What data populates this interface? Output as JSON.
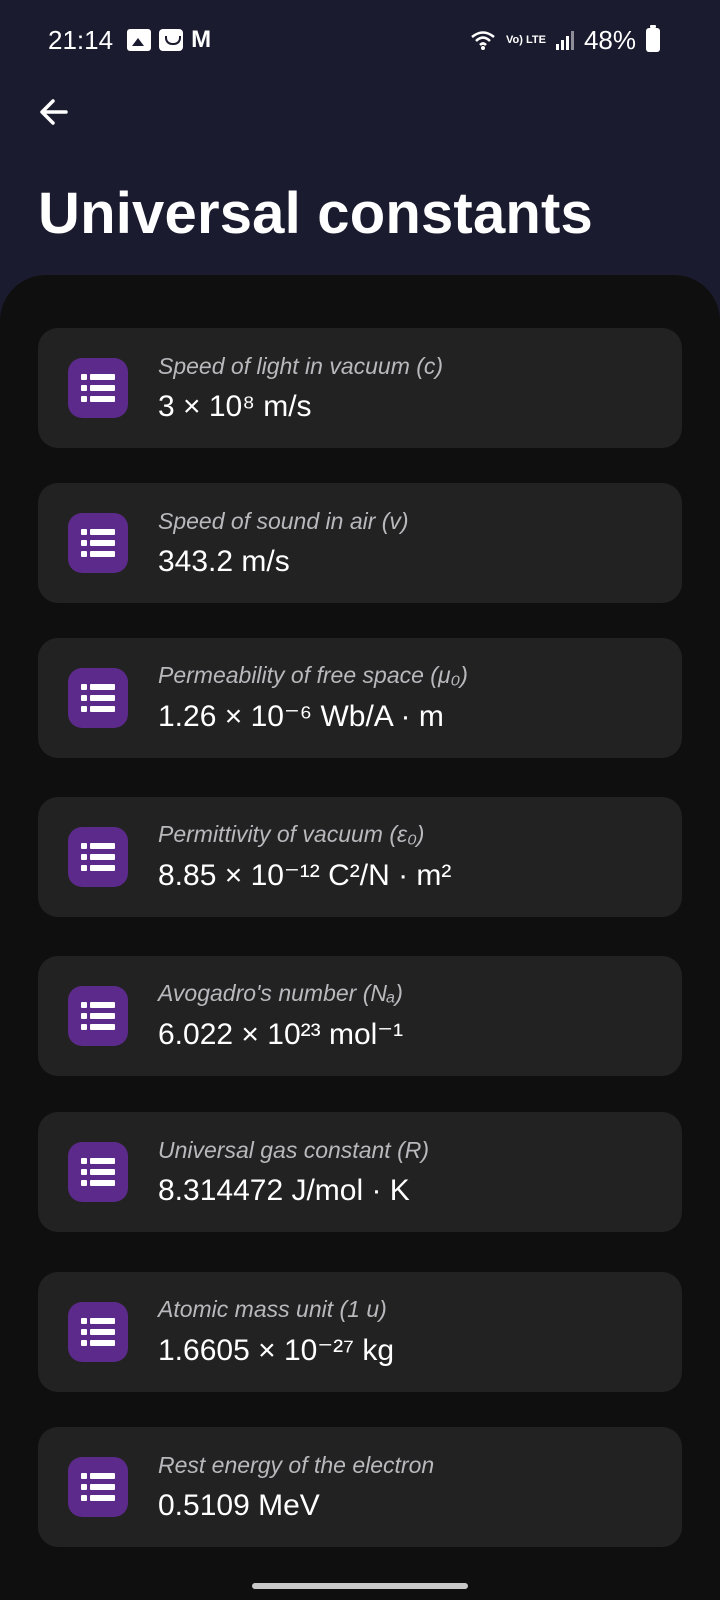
{
  "status_bar": {
    "time": "21:14",
    "mail_glyph": "M",
    "volte": "Vo) LTE",
    "battery": "48%"
  },
  "header": {
    "back_icon": "arrow-left-icon",
    "title": "Universal constants"
  },
  "constants": [
    {
      "label": "Speed of light in vacuum (c)",
      "value": "3 × 10⁸ m/s"
    },
    {
      "label": "Speed of sound in air (v)",
      "value": "343.2 m/s"
    },
    {
      "label": "Permeability of free space (μ₀)",
      "value": "1.26 × 10⁻⁶ Wb/A · m"
    },
    {
      "label": "Permittivity of vacuum (ε₀)",
      "value": "8.85 × 10⁻¹² C²/N · m²"
    },
    {
      "label": "Avogadro's number (Nₐ)",
      "value": "6.022 × 10²³ mol⁻¹"
    },
    {
      "label": "Universal gas constant (R)",
      "value": "8.314472 J/mol · K"
    },
    {
      "label": "Atomic mass unit (1 u)",
      "value": "1.6605 × 10⁻²⁷ kg"
    },
    {
      "label": "Rest energy of the electron",
      "value": "0.5109 MeV"
    }
  ],
  "colors": {
    "header_bg": "#1a1b2e",
    "sheet_bg": "#0f0f10",
    "card_bg": "#222223",
    "icon_bg": "#5b2a8a"
  },
  "item_icon": "list-icon"
}
